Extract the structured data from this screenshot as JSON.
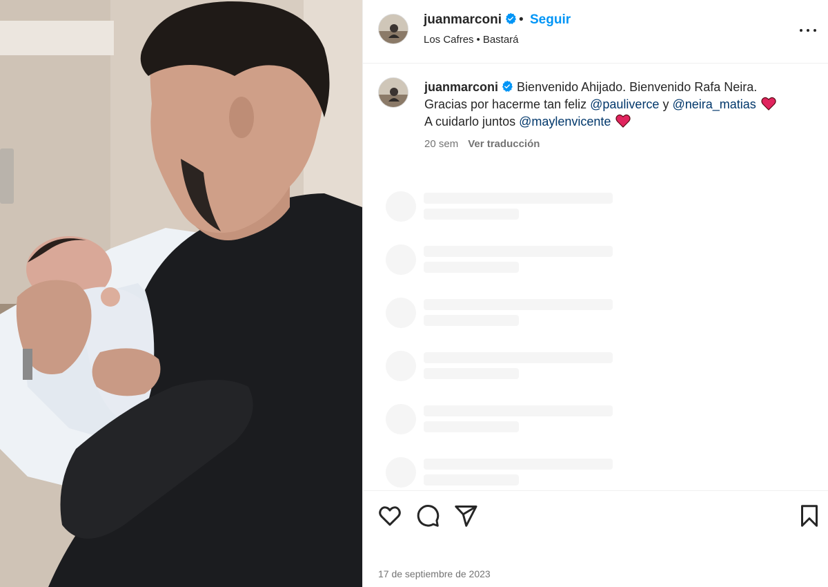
{
  "post": {
    "username": "juanmarconi",
    "follow_label": "Seguir",
    "separator": "•",
    "audio": {
      "artist": "Los Cafres",
      "song": "Bastará"
    },
    "caption": {
      "line1": "Bienvenido Ahijado. Bienvenido Rafa Neira.",
      "line2_prefix": "Gracias por hacerme tan feliz",
      "mention1": "@pauliverce",
      "line2_joiner": "y",
      "mention2": "@neira_matias",
      "line3_prefix": "A cuidarlo juntos",
      "mention3": "@maylenvicente"
    },
    "time_ago": "20 sem",
    "translate_label": "Ver traducción",
    "date": "17 de septiembre de 2023"
  },
  "icons": {
    "verified": "verified-badge-icon",
    "more": "more-options-icon",
    "like": "heart-outline-icon",
    "comment": "comment-bubble-icon",
    "share": "paper-plane-icon",
    "save": "bookmark-icon",
    "heart_emoji": "red-heart-emoji"
  },
  "colors": {
    "accent": "#0095f6",
    "mention": "#00376b",
    "muted": "#737373",
    "heart": "#e0245e",
    "verified": "#0095f6"
  }
}
